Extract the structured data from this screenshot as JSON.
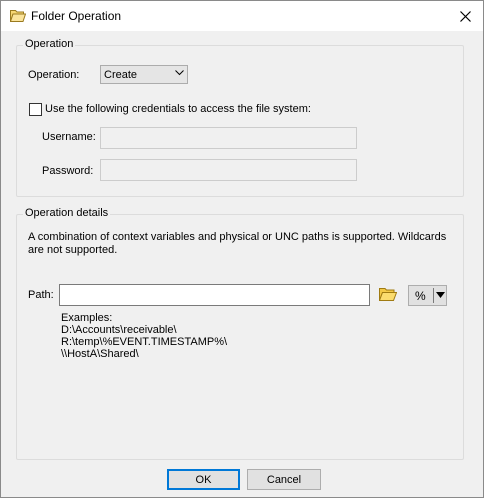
{
  "window": {
    "title": "Folder Operation",
    "title_icon": "folder-icon",
    "close_icon": "close-icon"
  },
  "operation_group": {
    "title": "Operation",
    "operation_label": "Operation:",
    "operation_value": "Create",
    "credentials_checkbox_label": "Use the following credentials to access the file system:",
    "credentials_checked": false,
    "username_label": "Username:",
    "username_value": "",
    "password_label": "Password:",
    "password_value": ""
  },
  "details_group": {
    "title": "Operation details",
    "description": "A combination of context variables and physical or UNC paths is supported. Wildcards are not supported.",
    "path_label": "Path:",
    "path_value": "",
    "browse_icon": "folder-open-icon",
    "variables_button_label": "%",
    "examples_title": "Examples:",
    "examples": [
      "D:\\Accounts\\receivable\\",
      "R:\\temp\\%EVENT.TIMESTAMP%\\",
      "\\\\HostA\\Shared\\"
    ]
  },
  "buttons": {
    "ok": "OK",
    "cancel": "Cancel"
  },
  "colors": {
    "focus_border": "#0078d7",
    "folder_yellow": "#e8b832"
  }
}
